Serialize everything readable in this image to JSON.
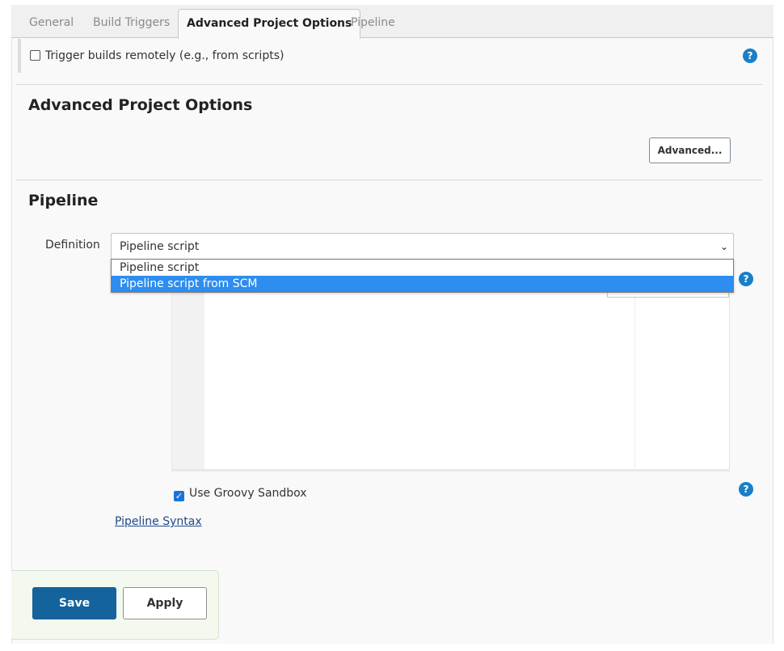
{
  "tabs": [
    {
      "label": "General"
    },
    {
      "label": "Build Triggers"
    },
    {
      "label": "Advanced Project Options"
    },
    {
      "label": "Pipeline"
    }
  ],
  "trigger": {
    "label": "Trigger builds remotely (e.g., from scripts)",
    "checked": false
  },
  "advanced_section": {
    "title": "Advanced Project Options",
    "advanced_button": "Advanced..."
  },
  "pipeline_section": {
    "title": "Pipeline",
    "definition_label": "Definition",
    "definition_selected": "Pipeline script",
    "definition_options": [
      {
        "label": "Pipeline script",
        "highlighted": false
      },
      {
        "label": "Pipeline script from SCM",
        "highlighted": true
      }
    ],
    "sandbox_label": "Use Groovy Sandbox",
    "sandbox_checked": true,
    "syntax_link": "Pipeline Syntax"
  },
  "footer": {
    "save_label": "Save",
    "apply_label": "Apply"
  },
  "icons": {
    "help": "help-icon",
    "chevron": "chevron-down-icon",
    "checkmark": "checkmark-icon"
  },
  "colors": {
    "primary_button": "#14639c",
    "highlight": "#2d8df0",
    "help_icon": "#1a7fc9"
  }
}
